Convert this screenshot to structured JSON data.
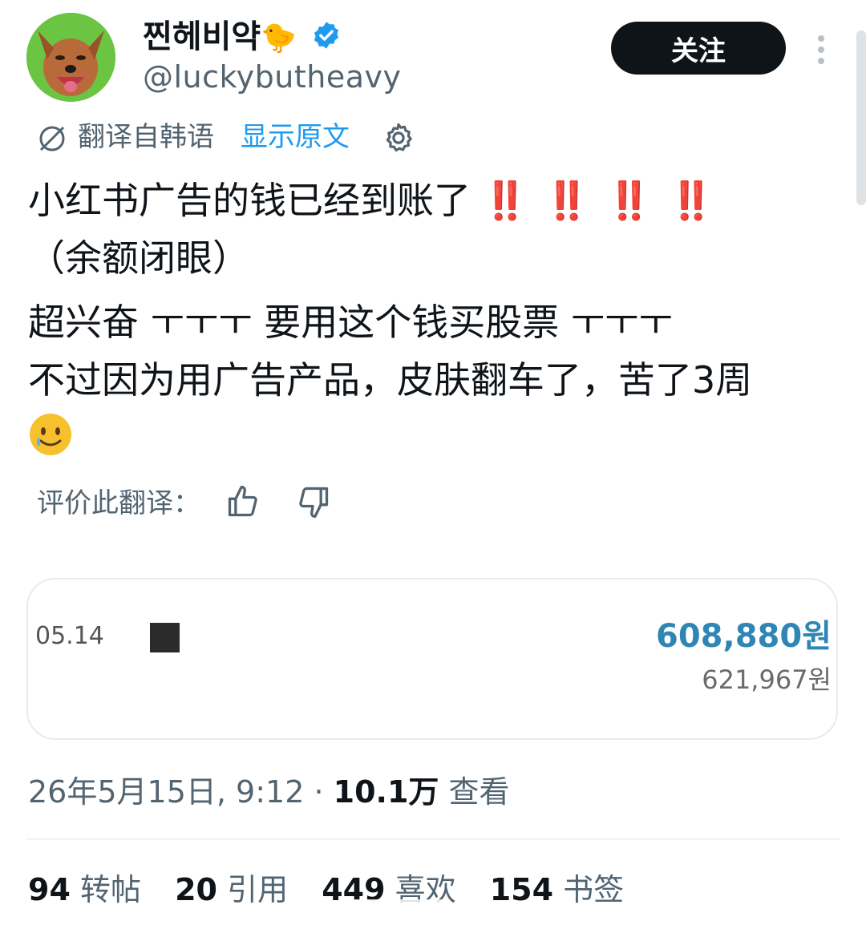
{
  "header": {
    "display_name": "찐헤비약",
    "name_emoji": "🐤",
    "handle": "@luckybutheavy",
    "follow_label": "关注",
    "verified_color": "#1d9bf0"
  },
  "translation": {
    "from_label": "翻译自韩语",
    "show_original": "显示原文"
  },
  "tweet": {
    "line1": "小红书广告的钱已经到账了",
    "line1_marks": "‼️ ‼️ ‼️ ‼️",
    "line2": "（余额闭眼）",
    "line3": "超兴奋 ㅜㅜㅜ 要用这个钱买股票 ㅜㅜㅜ",
    "line4": "不过因为用广告产品，皮肤翻车了，苦了3周",
    "emoji": "🥲"
  },
  "rating": {
    "label": "评价此翻译："
  },
  "card": {
    "date": "05.14",
    "amount": "608,880원",
    "balance": "621,967원"
  },
  "meta": {
    "timestamp": "26年5月15日, 9:12",
    "separator": "·",
    "views_count": "10.1万",
    "views_label": "查看"
  },
  "stats": [
    {
      "count": "94",
      "label": "转帖"
    },
    {
      "count": "20",
      "label": "引用"
    },
    {
      "count": "449",
      "label": "喜欢"
    },
    {
      "count": "154",
      "label": "书签"
    }
  ],
  "colors": {
    "accent": "#1d9bf0",
    "text": "#0f1419",
    "muted": "#536471",
    "amount": "#2f86b5",
    "alert": "#e0245e"
  }
}
